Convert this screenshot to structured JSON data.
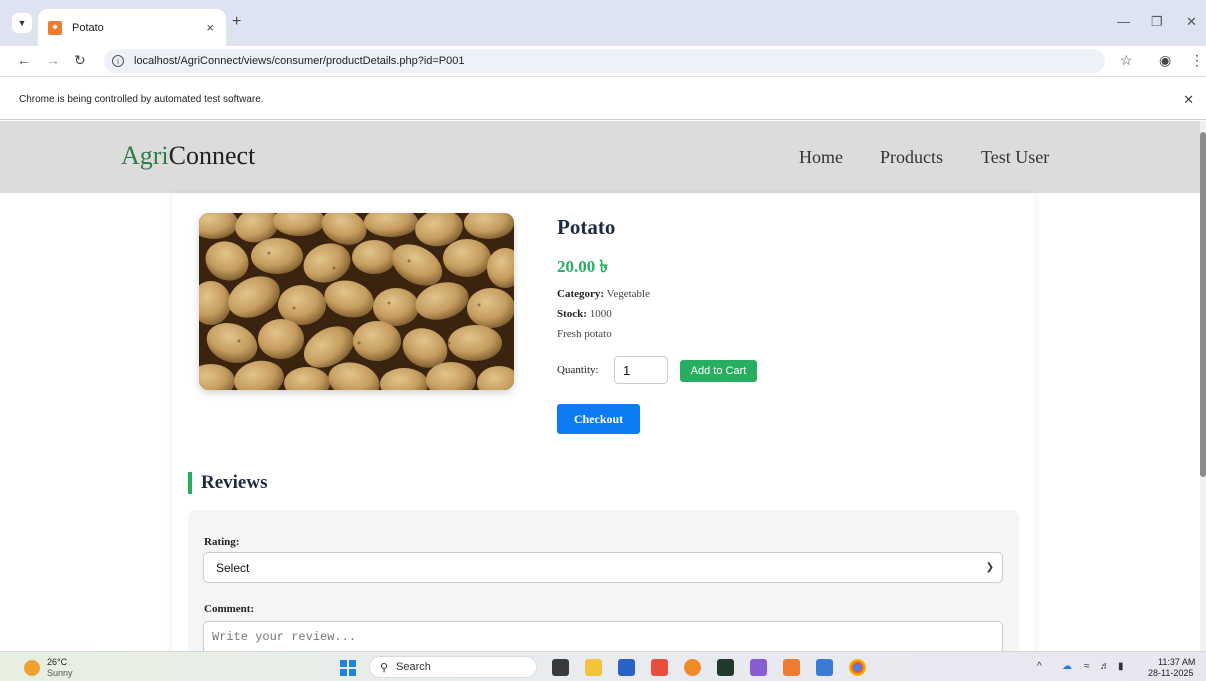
{
  "browser": {
    "tab_title": "Potato",
    "tab_close": "×",
    "new_tab": "+",
    "url": "localhost/AgriConnect/views/consumer/productDetails.php?id=P001",
    "infobar_text": "Chrome is being controlled by automated test software."
  },
  "site": {
    "brand_prefix": "Agri",
    "brand_suffix": "Connect",
    "nav": [
      "Home",
      "Products",
      "Test User"
    ]
  },
  "product": {
    "name": "Potato",
    "price": "20.00 ৳",
    "category_label": "Category:",
    "category": "Vegetable",
    "stock_label": "Stock:",
    "stock": "1000",
    "description": "Fresh potato",
    "quantity_label": "Quantity:",
    "quantity": "1",
    "add_to_cart": "Add to Cart",
    "checkout": "Checkout"
  },
  "reviews": {
    "title": "Reviews",
    "rating_label": "Rating:",
    "rating_selected": "Select",
    "comment_label": "Comment:",
    "comment_placeholder": "Write your review..."
  },
  "taskbar": {
    "temperature": "26°C",
    "weather": "Sunny",
    "search": "Search",
    "time": "11:37 AM",
    "date": "28-11-2025"
  },
  "colors": {
    "accent_green": "#27ae60",
    "checkout_blue": "#0d7cf2",
    "header_gray": "#dcdcdc"
  }
}
